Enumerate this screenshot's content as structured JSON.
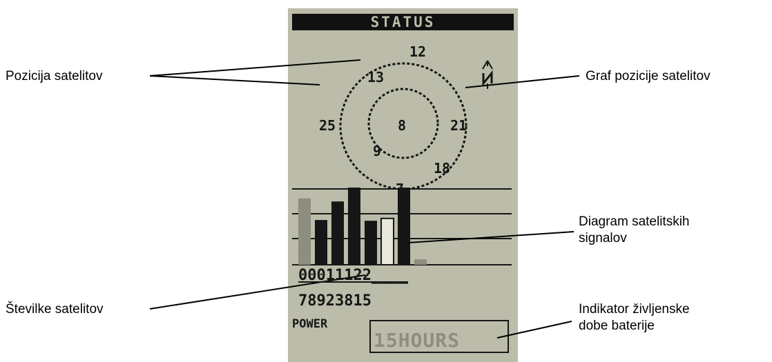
{
  "screen": {
    "title": "STATUS",
    "north_label": "N",
    "icon_north": "north-arrow-icon",
    "sky_plot": {
      "satellites": [
        {
          "id": "12",
          "ring": "outer",
          "azimuth_deg": 5
        },
        {
          "id": "13",
          "ring": "inner",
          "azimuth_deg": 315
        },
        {
          "id": "8",
          "ring": "center",
          "azimuth_deg": 0
        },
        {
          "id": "25",
          "ring": "outer",
          "azimuth_deg": 270
        },
        {
          "id": "21",
          "ring": "outer",
          "azimuth_deg": 90
        },
        {
          "id": "9",
          "ring": "inner",
          "azimuth_deg": 225
        },
        {
          "id": "18",
          "ring": "outer",
          "azimuth_deg": 130
        },
        {
          "id": "7",
          "ring": "outer",
          "azimuth_deg": 180
        }
      ]
    },
    "signal_bars": [
      {
        "level": 0.86,
        "style": "gray"
      },
      {
        "level": 0.58,
        "style": "dark"
      },
      {
        "level": 0.82,
        "style": "dark"
      },
      {
        "level": 1.0,
        "style": "dark"
      },
      {
        "level": 0.57,
        "style": "dark"
      },
      {
        "level": 0.6,
        "style": "hollow"
      },
      {
        "level": 1.0,
        "style": "dark"
      },
      {
        "level": 0.07,
        "style": "gray"
      }
    ],
    "sat_numbers_row1": "00011122____",
    "sat_numbers_row2": "78923815",
    "power_label": "POWER",
    "power_value": "15HOURS"
  },
  "callouts": {
    "sat_positions": "Pozicija satelitov",
    "sky_graph": "Graf pozicije satelitov",
    "signal_diagram_line1": "Diagram satelitskih",
    "signal_diagram_line2": "signalov",
    "sat_numbers": "Številke satelitov",
    "battery_line1": "Indikator življenske",
    "battery_line2": "dobe baterije"
  },
  "colors": {
    "lcd_background": "#bcbcaa",
    "lcd_ink": "#161616",
    "lcd_gray_ink": "#8e8e80"
  }
}
